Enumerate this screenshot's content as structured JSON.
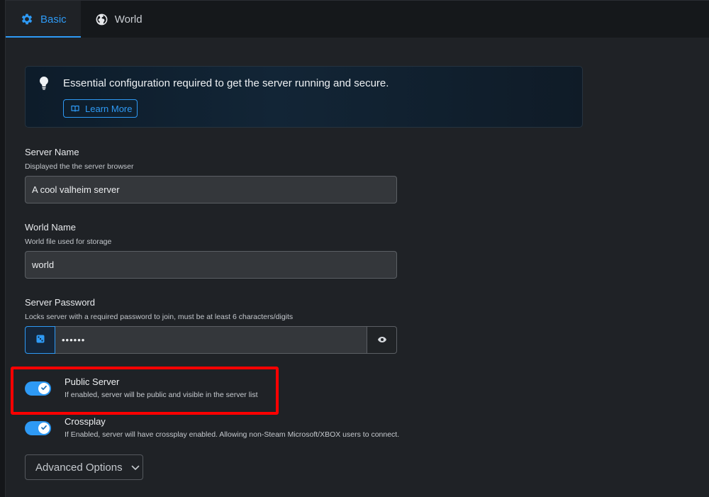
{
  "tabs": [
    {
      "label": "Basic",
      "icon": "gear-icon",
      "active": true
    },
    {
      "label": "World",
      "icon": "globe-icon",
      "active": false
    }
  ],
  "callout": {
    "icon": "lightbulb-icon",
    "message": "Essential configuration required to get the server running and secure.",
    "button_label": "Learn More",
    "button_icon": "book-icon"
  },
  "fields": {
    "server_name": {
      "label": "Server Name",
      "help": "Displayed the the server browser",
      "value": "A cool valheim server"
    },
    "world_name": {
      "label": "World Name",
      "help": "World file used for storage",
      "value": "world"
    },
    "server_password": {
      "label": "Server Password",
      "help": "Locks server with a required password to join, must be at least 6 characters/digits",
      "value": "••••••",
      "generate_icon": "dice-icon",
      "reveal_icon": "eye-icon"
    }
  },
  "toggles": {
    "public_server": {
      "title": "Public Server",
      "help": "If enabled, server will be public and visible in the server list",
      "enabled": true
    },
    "crossplay": {
      "title": "Crossplay",
      "help": "If Enabled, server will have crossplay enabled. Allowing non-Steam Microsoft/XBOX users to connect.",
      "enabled": true
    }
  },
  "advanced": {
    "label": "Advanced Options",
    "icon": "chevron-down-icon"
  },
  "colors": {
    "accent": "#2e9af5",
    "background": "#1f2226",
    "highlight": "#ff0000"
  }
}
